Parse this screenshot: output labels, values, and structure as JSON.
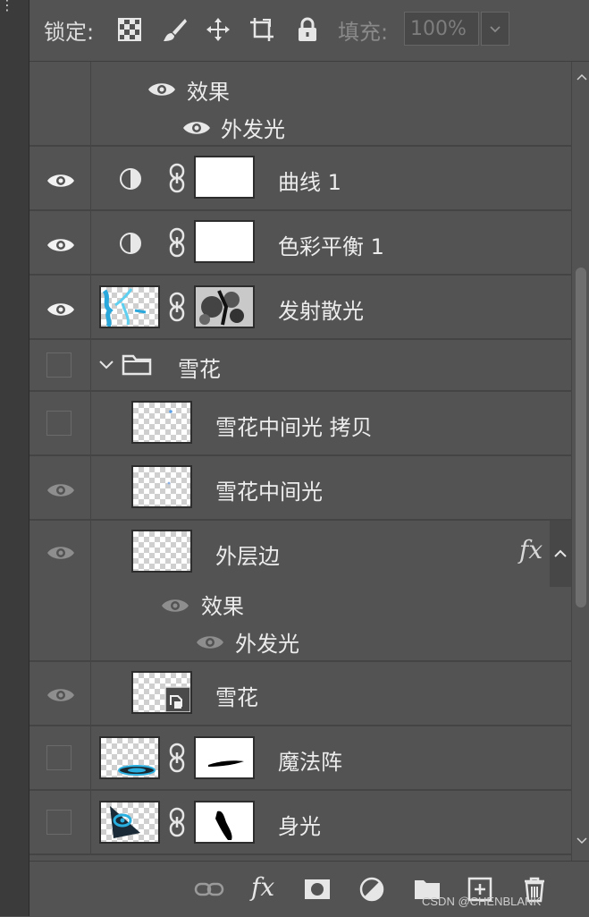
{
  "lock_bar": {
    "lock_label": "锁定:",
    "fill_label": "填充:",
    "fill_value": "100%",
    "icons": [
      "lock-transparent-pixels-icon",
      "lock-image-pixels-icon",
      "lock-position-icon",
      "lock-artboard-icon",
      "lock-all-icon"
    ]
  },
  "layers": {
    "effects_top": {
      "effects_label": "效果",
      "effect_name": "外发光"
    },
    "curves": {
      "name": "曲线 1"
    },
    "color_balance": {
      "name": "色彩平衡 1"
    },
    "emit_light": {
      "name": "发射散光"
    },
    "group_snow": {
      "name": "雪花"
    },
    "snow_mid_copy": {
      "name": "雪花中间光 拷贝"
    },
    "snow_mid": {
      "name": "雪花中间光"
    },
    "outer_edge": {
      "name": "外层边",
      "fx": "fx",
      "effects_label": "效果",
      "effect_name": "外发光"
    },
    "snow_smart": {
      "name": "雪花"
    },
    "magic_circle": {
      "name": "魔法阵"
    },
    "body_light": {
      "name": "身光"
    }
  },
  "bottom_bar": {
    "icons": [
      "link-layers-icon",
      "fx-icon",
      "add-mask-icon",
      "adjustment-layer-icon",
      "new-group-icon",
      "new-layer-icon",
      "delete-layer-icon"
    ],
    "fx_text": "fx"
  },
  "watermark": "CSDN @CHENBLANK",
  "colors": {
    "panel_bg": "#535353",
    "row_separator": "#444444",
    "accent_cyan": "#2ab0e0"
  }
}
